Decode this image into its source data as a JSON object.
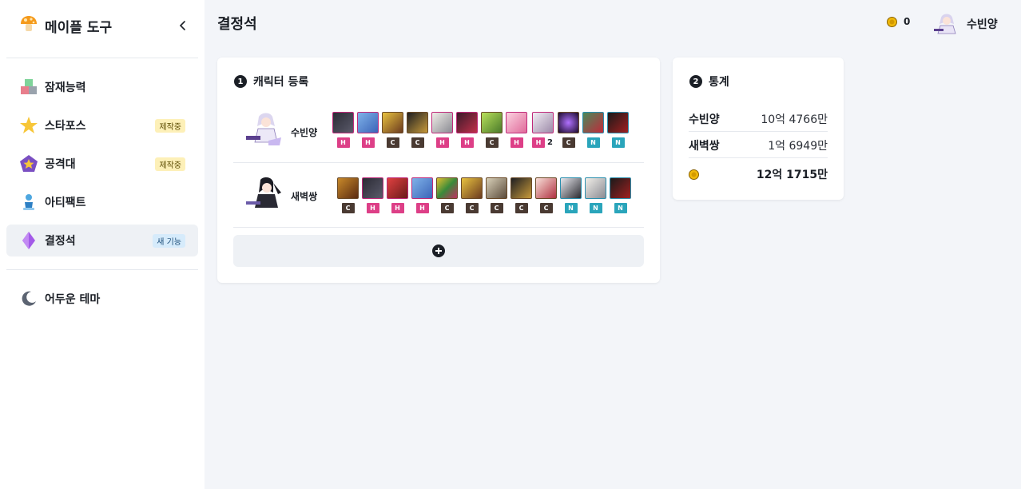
{
  "sidebar": {
    "brand_title": "메이플 도구",
    "items": [
      {
        "label": "잠재능력",
        "badge": ""
      },
      {
        "label": "스타포스",
        "badge": "제작중"
      },
      {
        "label": "공격대",
        "badge": "제작중"
      },
      {
        "label": "아티팩트",
        "badge": ""
      },
      {
        "label": "결정석",
        "badge": "새 기능"
      }
    ],
    "theme_toggle": "어두운 테마"
  },
  "header": {
    "title": "결정석",
    "coin_count": "0",
    "user_name": "수빈양"
  },
  "register_card": {
    "step": "1",
    "title": "캐릭터 등록",
    "characters": [
      {
        "name": "수빈양",
        "bosses": [
          {
            "difficulty": "H",
            "party": ""
          },
          {
            "difficulty": "H",
            "party": ""
          },
          {
            "difficulty": "C",
            "party": ""
          },
          {
            "difficulty": "C",
            "party": ""
          },
          {
            "difficulty": "H",
            "party": ""
          },
          {
            "difficulty": "H",
            "party": ""
          },
          {
            "difficulty": "C",
            "party": ""
          },
          {
            "difficulty": "H",
            "party": ""
          },
          {
            "difficulty": "H",
            "party": "2"
          },
          {
            "difficulty": "C",
            "party": ""
          },
          {
            "difficulty": "N",
            "party": ""
          },
          {
            "difficulty": "N",
            "party": ""
          }
        ]
      },
      {
        "name": "새벽쌍",
        "bosses": [
          {
            "difficulty": "C",
            "party": ""
          },
          {
            "difficulty": "H",
            "party": ""
          },
          {
            "difficulty": "H",
            "party": ""
          },
          {
            "difficulty": "H",
            "party": ""
          },
          {
            "difficulty": "C",
            "party": ""
          },
          {
            "difficulty": "C",
            "party": ""
          },
          {
            "difficulty": "C",
            "party": ""
          },
          {
            "difficulty": "C",
            "party": ""
          },
          {
            "difficulty": "C",
            "party": ""
          },
          {
            "difficulty": "N",
            "party": ""
          },
          {
            "difficulty": "N",
            "party": ""
          },
          {
            "difficulty": "N",
            "party": ""
          }
        ]
      }
    ]
  },
  "stats_card": {
    "step": "2",
    "title": "통계",
    "rows": [
      {
        "name": "수빈양",
        "value": "10억 4766만"
      },
      {
        "name": "새벽쌍",
        "value": "1억 6949만"
      }
    ],
    "total": "12억 1715만"
  },
  "colors": {
    "hard": "#dd3f87",
    "chaos": "#4a3a32",
    "normal": "#2aa5bb",
    "coin": "#f0b90b"
  }
}
